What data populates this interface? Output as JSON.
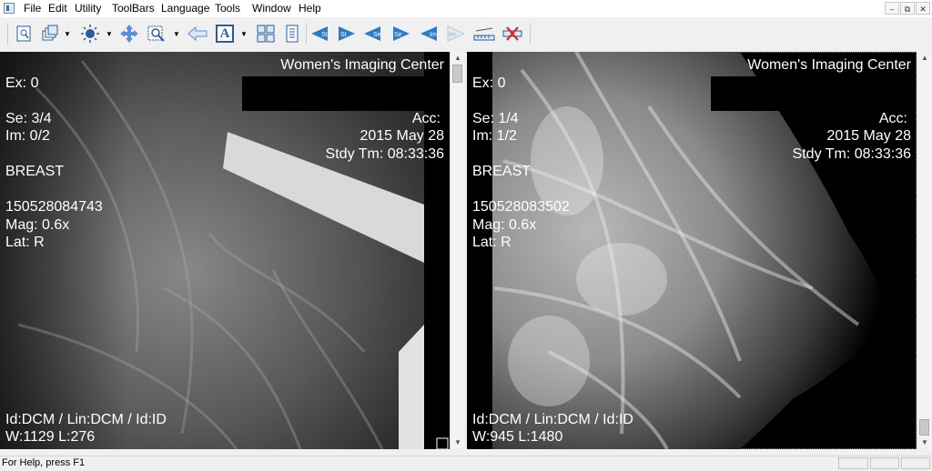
{
  "menu": {
    "items": [
      "File",
      "Edit",
      "Utility",
      "ToolBars",
      "Language",
      "Tools",
      "Window",
      "Help"
    ]
  },
  "window_controls": {
    "minimize": "–",
    "restore": "⧉",
    "close": "✕"
  },
  "toolbar": {
    "icons": [
      "page-icon",
      "stack-icon",
      "brightness-icon",
      "pan-icon",
      "zoom-icon",
      "back-arrow-icon",
      "text-annotation-icon",
      "grid-layout-icon",
      "list-icon",
      "prev-study-icon",
      "next-study-icon",
      "prev-series-icon",
      "next-series-icon",
      "prev-image-icon",
      "next-image-icon",
      "ruler-icon",
      "delete-measure-icon"
    ],
    "st_label": "St",
    "se_label": "Se",
    "im_label": "Im",
    "text_label": "A"
  },
  "viewports": [
    {
      "institution": "Women's Imaging Center",
      "exam": "Ex: 0",
      "series": "Se: 3/4",
      "image": "Im: 0/2",
      "body_part": "BREAST",
      "acc": "Acc:",
      "date": "2015 May 28",
      "study_time": "Stdy Tm: 08:33:36",
      "uid": "150528084743",
      "mag": "Mag: 0.6x",
      "lat": "Lat: R",
      "lut": "Id:DCM / Lin:DCM / Id:ID",
      "window_level": "W:1129  L:276"
    },
    {
      "institution": "Women's Imaging Center",
      "exam": "Ex: 0",
      "series": "Se: 1/4",
      "image": "Im: 1/2",
      "body_part": "BREAST",
      "acc": "Acc:",
      "date": "2015 May 28",
      "study_time": "Stdy Tm: 08:33:36",
      "uid": "150528083502",
      "mag": "Mag: 0.6x",
      "lat": "Lat: R",
      "lut": "Id:DCM / Lin:DCM / Id:ID",
      "window_level": "W:945  L:1480"
    }
  ],
  "status": {
    "message": "For Help, press F1"
  }
}
